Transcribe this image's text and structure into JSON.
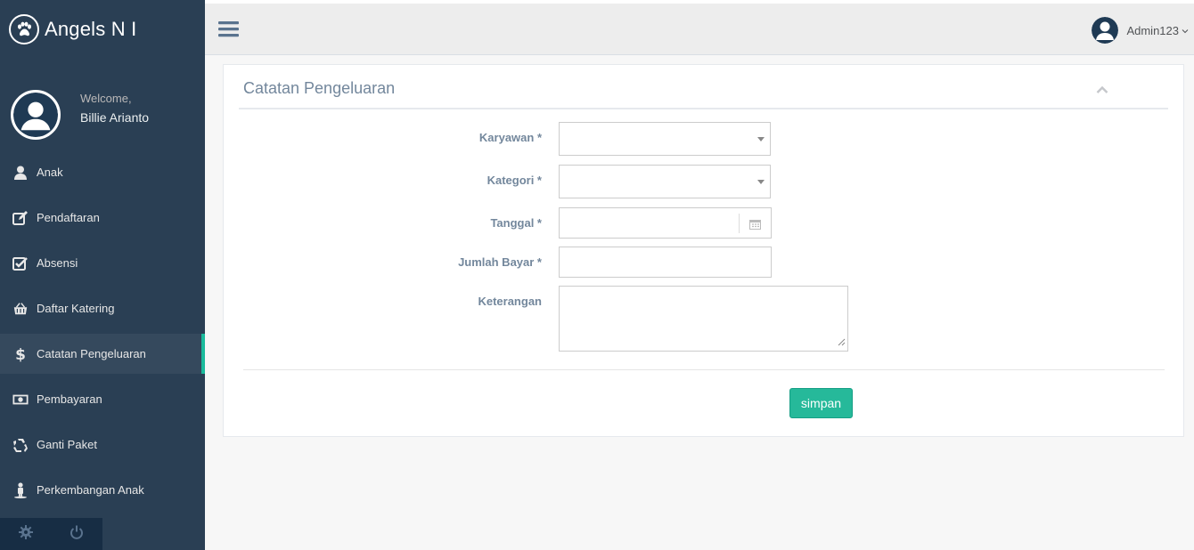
{
  "brand": {
    "title": "Angels N I",
    "logo_icon": "paw-icon"
  },
  "profile": {
    "welcome": "Welcome,",
    "name": "Billie Arianto"
  },
  "sidebar": {
    "items": [
      {
        "label": "Anak",
        "icon": "user-icon"
      },
      {
        "label": "Pendaftaran",
        "icon": "edit-icon"
      },
      {
        "label": "Absensi",
        "icon": "check-square-icon"
      },
      {
        "label": "Daftar Katering",
        "icon": "basket-icon"
      },
      {
        "label": "Catatan Pengeluaran",
        "icon": "dollar-icon",
        "active": true
      },
      {
        "label": "Pembayaran",
        "icon": "money-icon"
      },
      {
        "label": "Ganti Paket",
        "icon": "recycle-icon"
      },
      {
        "label": "Perkembangan Anak",
        "icon": "male-icon"
      }
    ],
    "footer": [
      "settings-icon",
      "power-icon"
    ]
  },
  "topnav": {
    "user": "Admin123"
  },
  "panel": {
    "title": "Catatan Pengeluaran",
    "fields": {
      "karyawan": {
        "label": "Karyawan *",
        "value": ""
      },
      "kategori": {
        "label": "Kategori *",
        "value": ""
      },
      "tanggal": {
        "label": "Tanggal *",
        "value": ""
      },
      "jumlah": {
        "label": "Jumlah Bayar *",
        "value": ""
      },
      "keterangan": {
        "label": "Keterangan",
        "value": ""
      }
    },
    "submit_label": "simpan"
  },
  "colors": {
    "sidebar": "#2a3f54",
    "accent": "#1abb9c",
    "button": "#26b99a"
  }
}
